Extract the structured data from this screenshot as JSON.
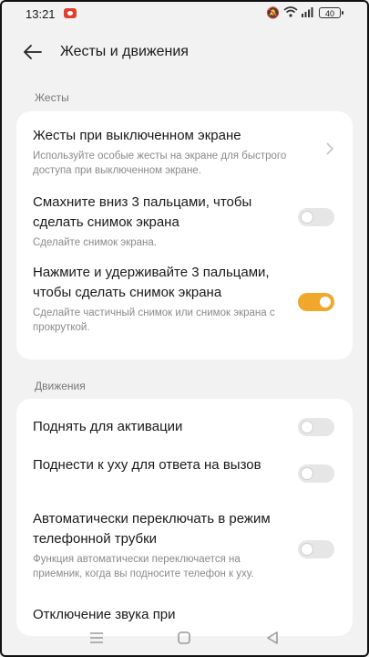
{
  "status_bar": {
    "time": "13:21",
    "battery": "40"
  },
  "header": {
    "title": "Жесты и движения"
  },
  "sections": [
    {
      "label": "Жесты",
      "items": [
        {
          "title": "Жесты при выключенном экране",
          "subtitle": "Используйте особые жесты на экране для быстрого доступа при выключенном экране.",
          "control": "chevron"
        },
        {
          "title": "Смахните вниз 3 пальцами, чтобы сделать снимок экрана",
          "subtitle": "Сделайте снимок экрана.",
          "control": "toggle",
          "on": false
        },
        {
          "title": "Нажмите и удерживайте 3 пальцами, чтобы сделать снимок экрана",
          "subtitle": "Сделайте частичный снимок или снимок экрана с прокруткой.",
          "control": "toggle",
          "on": true
        }
      ]
    },
    {
      "label": "Движения",
      "items": [
        {
          "title": "Поднять для активации",
          "control": "toggle",
          "on": false
        },
        {
          "title": "Поднести к уху для ответа на вызов",
          "control": "toggle",
          "on": false
        },
        {
          "title": "Автоматически переключать в режим телефонной трубки",
          "subtitle": "Функция автоматически переключается на приемник, когда вы подносите телефон к уху.",
          "control": "toggle",
          "on": false
        },
        {
          "title": "Отключение звука при",
          "control": "none"
        }
      ]
    }
  ],
  "colors": {
    "accent": "#f0a72c",
    "background": "#f2f2f2",
    "card": "#ffffff"
  }
}
